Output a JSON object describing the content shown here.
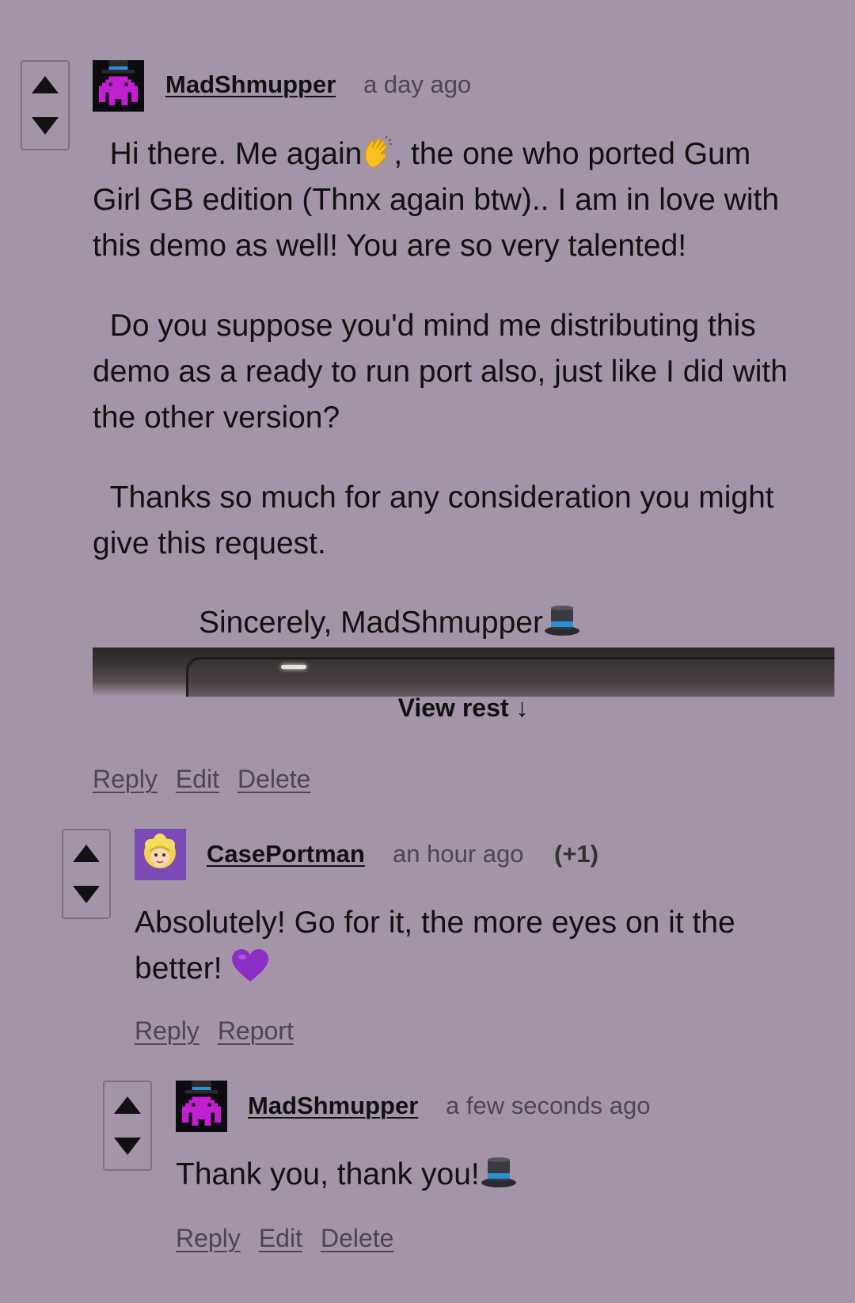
{
  "comments": [
    {
      "username": "MadShmupper",
      "timestamp": "a day ago",
      "paragraphs": [
        "Hi there. Me again",
        ", the one who ported Gum",
        "Girl GB edition (Thnx again btw).. I am in love with",
        "this demo as well! You are so very talented!",
        "Do you suppose you'd mind me distributing this",
        "demo as a ready to run port also, just like I did with",
        "the other version?",
        "Thanks so much for any consideration you might",
        "give this request.",
        "Sincerely, MadShmupper"
      ],
      "view_rest_label": "View rest ↓",
      "actions": {
        "reply": "Reply",
        "edit": "Edit",
        "delete": "Delete"
      }
    },
    {
      "username": "CasePortman",
      "timestamp": "an hour ago",
      "score": "(+1)",
      "lines": [
        "Absolutely! Go for it, the more eyes on it the",
        "better!"
      ],
      "actions": {
        "reply": "Reply",
        "report": "Report"
      }
    },
    {
      "username": "MadShmupper",
      "timestamp": "a few seconds ago",
      "lines": [
        "Thank you, thank you!"
      ],
      "actions": {
        "reply": "Reply",
        "edit": "Edit",
        "delete": "Delete"
      }
    }
  ],
  "colors": {
    "background": "#a494a7",
    "vote_border": "#7f6f82",
    "muted_text": "#4f4552",
    "avatar_purple": "#7a4bb5"
  },
  "icons": [
    "upvote-arrow-icon",
    "downvote-arrow-icon",
    "waving-hand-emoji",
    "top-hat-emoji",
    "purple-heart-emoji"
  ]
}
